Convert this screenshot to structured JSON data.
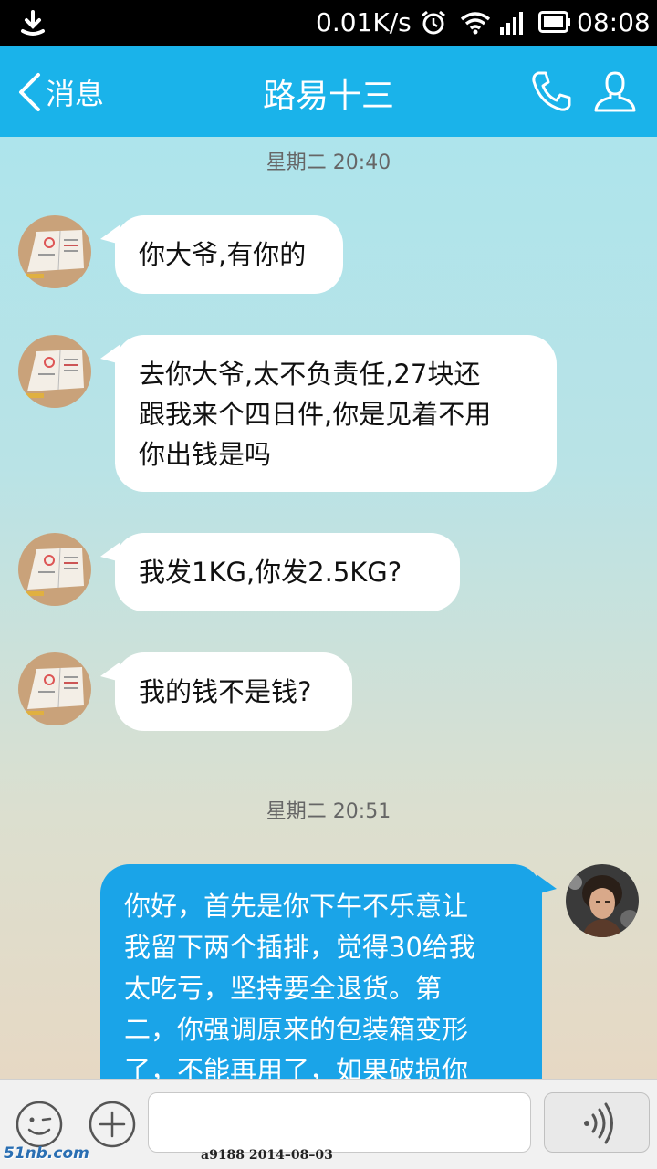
{
  "status_bar": {
    "net_speed": "0.01K/s",
    "time": "08:08",
    "icons": [
      "download-icon",
      "alarm-icon",
      "wifi-icon",
      "signal-icon",
      "battery-icon"
    ]
  },
  "nav": {
    "back_label": "消息",
    "title": "路易十三",
    "icons": [
      "phone-icon",
      "contact-icon"
    ],
    "color": "#1ab3ea"
  },
  "chat": {
    "timestamps": [
      "星期二 20:40",
      "星期二 20:51"
    ],
    "incoming": [
      {
        "lines": [
          "你大爷,有你的"
        ]
      },
      {
        "lines": [
          "去你大爷,太不负责任,27块还",
          "跟我来个四日件,你是见着不用",
          "你出钱是吗"
        ]
      },
      {
        "lines": [
          "我发1KG,你发2.5KG?"
        ]
      },
      {
        "lines": [
          "我的钱不是钱?"
        ]
      }
    ],
    "outgoing": [
      {
        "lines": [
          "你好，首先是你下午不乐意让",
          "我留下两个插排，觉得30给我",
          "太吃亏，坚持要全退货。第",
          "二，你强调原来的包装箱变形",
          "了，不能再用了，如果破损你"
        ]
      }
    ],
    "outgoing_color": "#1aa4e8"
  },
  "input_bar": {
    "icons": [
      "emoji-icon",
      "plus-icon",
      "voice-icon"
    ]
  },
  "watermark": {
    "logo": "51nb.com",
    "text": "a9188    2014–08–03"
  }
}
